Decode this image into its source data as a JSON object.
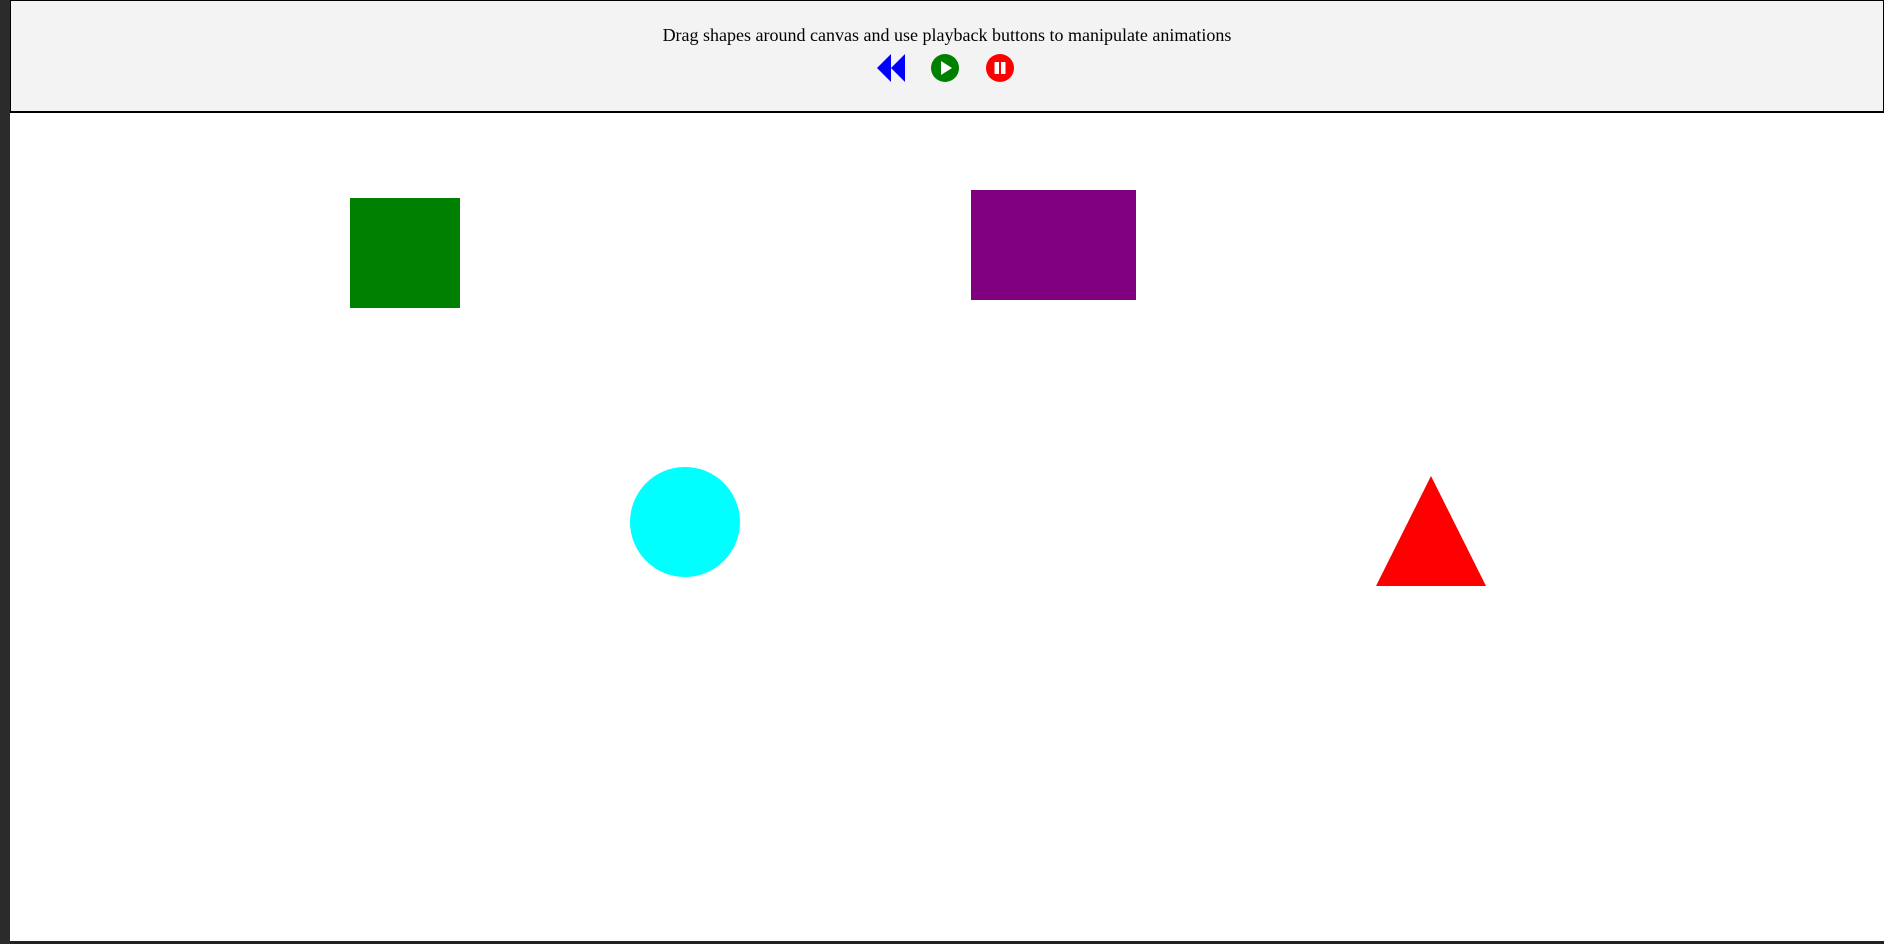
{
  "header": {
    "instructions": "Drag shapes around canvas and use playback buttons to manipulate animations"
  },
  "controls": {
    "rewind": {
      "icon": "rewind-icon",
      "color": "#0000ff"
    },
    "play": {
      "icon": "play-icon",
      "color": "#008000"
    },
    "pause": {
      "icon": "pause-icon",
      "color": "#ff0000"
    }
  },
  "shapes": {
    "square": {
      "color": "#008000"
    },
    "rectangle": {
      "color": "#800080"
    },
    "circle": {
      "color": "#00ffff"
    },
    "triangle": {
      "color": "#ff0000"
    }
  }
}
